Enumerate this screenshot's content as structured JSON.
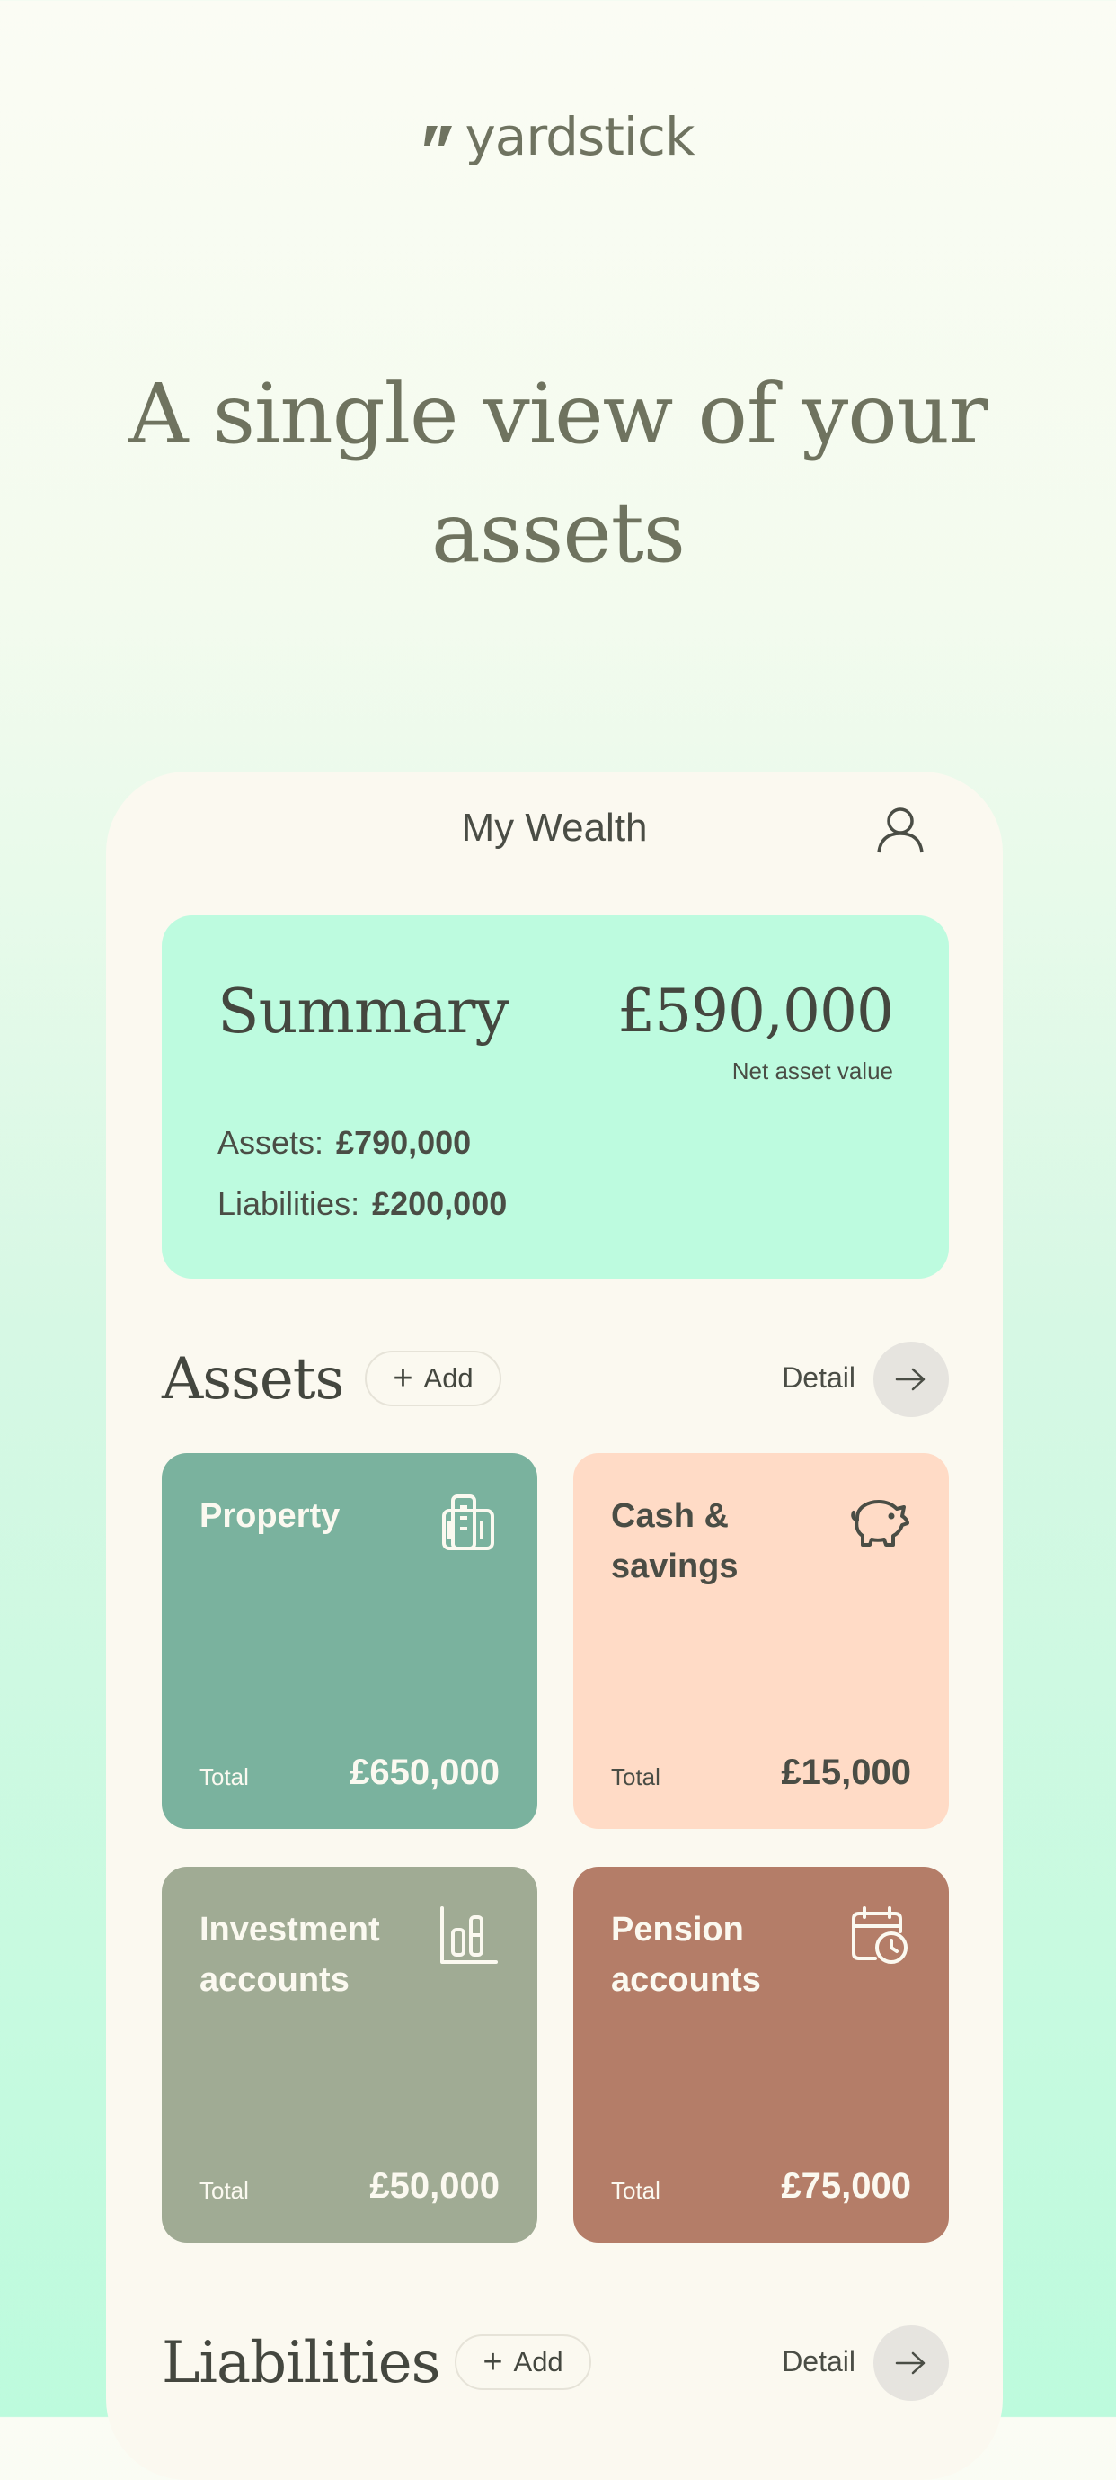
{
  "brand": {
    "name": "yardstick"
  },
  "hero": {
    "line1": "A single view of your",
    "line2": "assets"
  },
  "app": {
    "title": "My Wealth",
    "summary": {
      "title": "Summary",
      "net_value": "£590,000",
      "net_label": "Net asset value",
      "assets_label": "Assets:",
      "assets_value": "£790,000",
      "liabilities_label": "Liabilities:",
      "liabilities_value": "£200,000"
    },
    "assets_section": {
      "title": "Assets",
      "add_label": "Add",
      "detail_label": "Detail"
    },
    "cards": [
      {
        "title": "Property",
        "total_label": "Total",
        "total": "£650,000",
        "color": "#7ab29e",
        "icon": "building-icon"
      },
      {
        "title": "Cash & savings",
        "total_label": "Total",
        "total": "£15,000",
        "color": "#ffdbc6",
        "icon": "piggy-bank-icon"
      },
      {
        "title": "Investment accounts",
        "total_label": "Total",
        "total": "£50,000",
        "color": "#a0ab94",
        "icon": "bar-chart-icon"
      },
      {
        "title": "Pension accounts",
        "total_label": "Total",
        "total": "£75,000",
        "color": "#b47d68",
        "icon": "calendar-clock-icon"
      }
    ],
    "liabilities_section": {
      "title": "Liabilities",
      "add_label": "Add",
      "detail_label": "Detail"
    }
  }
}
